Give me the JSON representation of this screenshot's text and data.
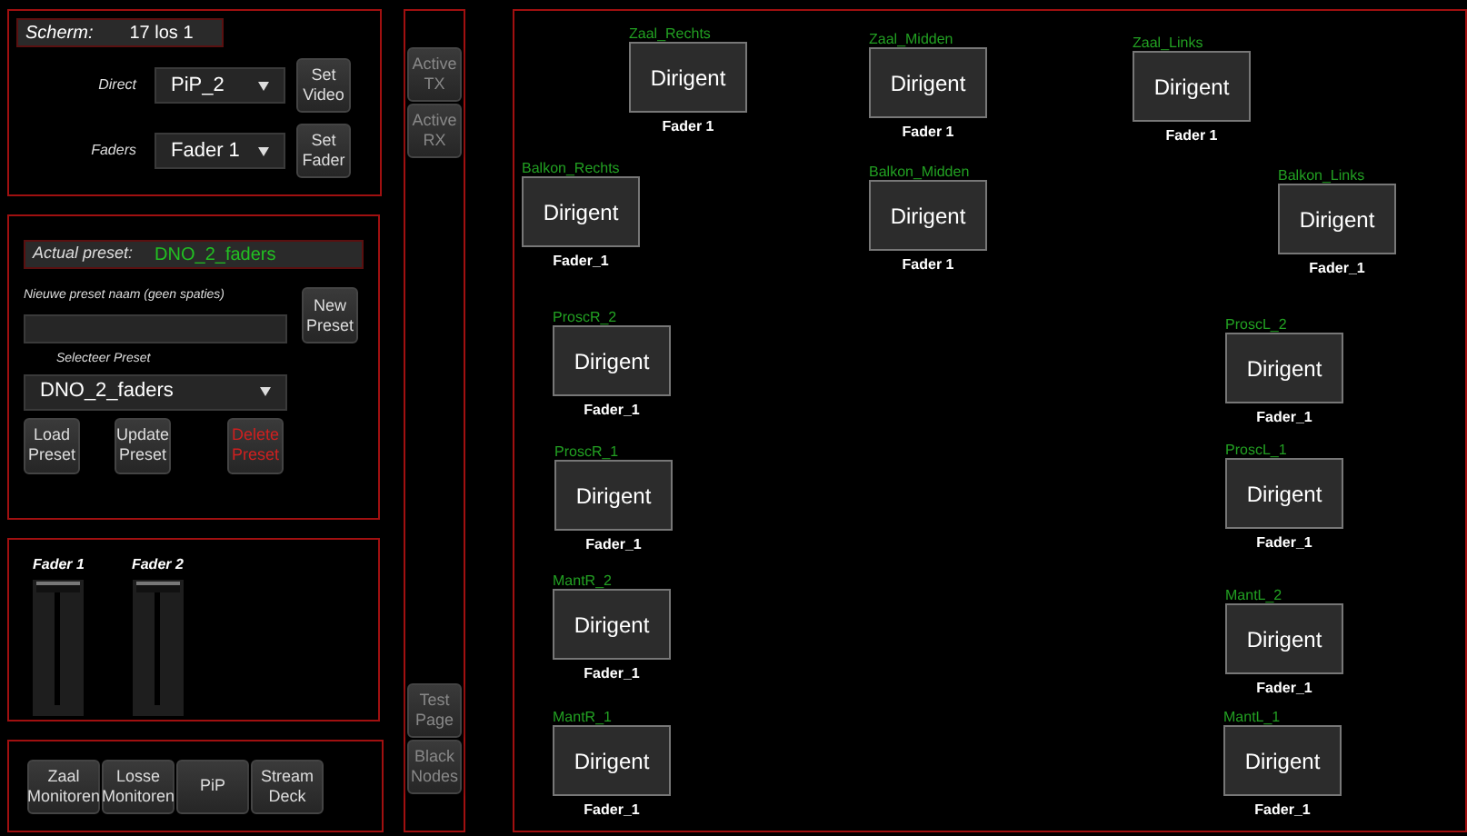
{
  "screen": {
    "label": "Scherm:",
    "value": "17 los 1"
  },
  "routing": [
    {
      "label": "Direct",
      "value": "PiP_2",
      "button": "Set Video"
    },
    {
      "label": "Faders",
      "value": "Fader 1",
      "button": "Set Fader"
    }
  ],
  "preset": {
    "actual_label": "Actual preset:",
    "actual_value": "DNO_2_faders",
    "new_label": "Nieuwe preset naam (geen spaties)",
    "new_button": "New Preset",
    "select_label": "Selecteer Preset",
    "select_value": "DNO_2_faders",
    "buttons": [
      {
        "label": "Load Preset",
        "danger": false
      },
      {
        "label": "Update Preset",
        "danger": false
      },
      {
        "label": "Delete Preset",
        "danger": true
      }
    ]
  },
  "faders": [
    {
      "label": "Fader 1",
      "level": 1
    },
    {
      "label": "Fader 2",
      "level": 1
    }
  ],
  "pages": [
    "Zaal Monitoren",
    "Losse Monitoren",
    "PiP",
    "Stream Deck"
  ],
  "side_buttons": [
    {
      "label": "Active TX",
      "disabled": true
    },
    {
      "label": "Active RX",
      "disabled": true
    },
    {
      "label": "Test Page",
      "disabled": true
    },
    {
      "label": "Black Nodes",
      "disabled": true
    }
  ],
  "nodes": [
    {
      "name": "Zaal_Rechts",
      "source": "Dirigent",
      "fader": "Fader 1"
    },
    {
      "name": "Zaal_Midden",
      "source": "Dirigent",
      "fader": "Fader 1"
    },
    {
      "name": "Zaal_Links",
      "source": "Dirigent",
      "fader": "Fader 1"
    },
    {
      "name": "Balkon_Rechts",
      "source": "Dirigent",
      "fader": "Fader_1"
    },
    {
      "name": "Balkon_Midden",
      "source": "Dirigent",
      "fader": "Fader 1"
    },
    {
      "name": "Balkon_Links",
      "source": "Dirigent",
      "fader": "Fader_1"
    },
    {
      "name": "ProscR_2",
      "source": "Dirigent",
      "fader": "Fader_1"
    },
    {
      "name": "ProscL_2",
      "source": "Dirigent",
      "fader": "Fader_1"
    },
    {
      "name": "ProscR_1",
      "source": "Dirigent",
      "fader": "Fader_1"
    },
    {
      "name": "ProscL_1",
      "source": "Dirigent",
      "fader": "Fader_1"
    },
    {
      "name": "MantR_2",
      "source": "Dirigent",
      "fader": "Fader_1"
    },
    {
      "name": "MantL_2",
      "source": "Dirigent",
      "fader": "Fader_1"
    },
    {
      "name": "MantR_1",
      "source": "Dirigent",
      "fader": "Fader_1"
    },
    {
      "name": "MantL_1",
      "source": "Dirigent",
      "fader": "Fader_1"
    }
  ]
}
